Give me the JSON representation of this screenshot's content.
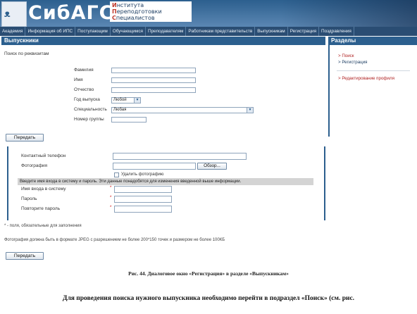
{
  "header": {
    "brand": "СибАГС",
    "logo_text": "ᴥ",
    "tagline": [
      "Института",
      "Переподготовки",
      "Специалистов"
    ]
  },
  "nav": [
    "Академия",
    "Информация об ИПС",
    "Поступающим",
    "Обучающимся",
    "Преподавателям",
    "Работникам представительств",
    "Выпускникам",
    "Регистрация",
    "Поздравления"
  ],
  "section_title": "Выпускники",
  "sidebar": {
    "title": "Разделы",
    "links": [
      "> Поиск",
      "> Регистрация",
      "> Редактирование профиля"
    ]
  },
  "search": {
    "heading": "Поиск по реквизитам",
    "labels": {
      "surname": "Фамилия",
      "name": "Имя",
      "patronymic": "Отчество",
      "grad_year": "Год выпуска",
      "specialty": "Специальность",
      "group": "Номер группы"
    },
    "grad_year_value": "Любой",
    "specialty_value": "Любая",
    "submit_label": "Передать"
  },
  "registration": {
    "phone_label": "Контактный телефон",
    "photo_label": "Фотография",
    "browse_label": "Обзор...",
    "delete_photo_label": "Удалить фотографию",
    "info_bar": "Введите имя входа в систему и пароль. Эти данные понадобятся для изменения введенной выше информации.",
    "login_label": "Имя входа в систему",
    "password_label": "Пароль",
    "repeat_password_label": "Повторите пароль",
    "required_note": "* - поля, обязательные для заполнения",
    "photo_note": "Фотография должна быть в формате JPEG с разрешением не более 200*150 точек и размером не более 100КБ",
    "submit_label": "Передать"
  },
  "caption": "Рис. 44. Диалоговое окно «Регистрация» в разделе «Выпускникам»",
  "body_text": "Для проведения поиска нужного выпускника необходимо перейти в подраздел «Поиск» (см. рис.",
  "colors": {
    "header_blue": "#2c5f8e",
    "nav_blue": "#2a4d73",
    "link_red": "#b02323"
  }
}
